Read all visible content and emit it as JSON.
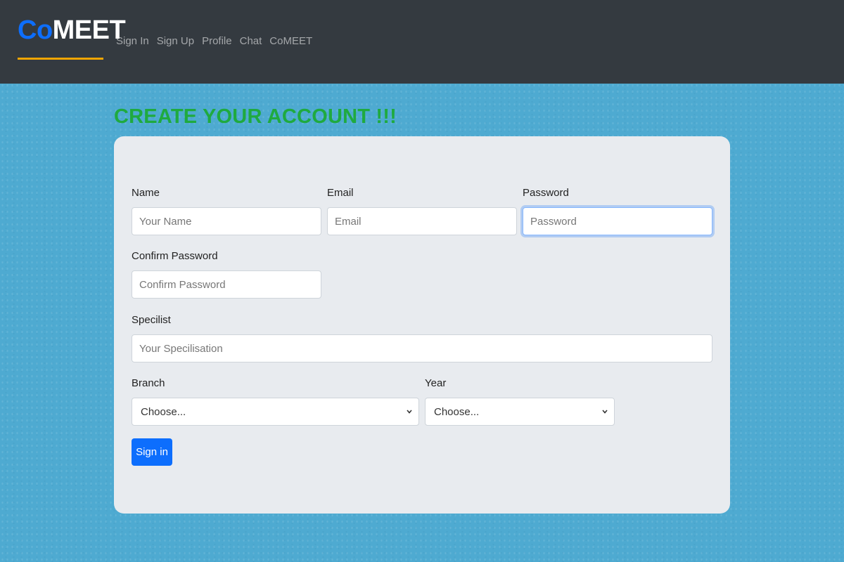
{
  "nav": {
    "brand_co": "Co",
    "brand_meet": "MEET",
    "links": [
      "Sign In",
      "Sign Up",
      "Profile",
      "Chat",
      "CoMEET"
    ],
    "brand_accent_color": "#0d6efd",
    "underline_color": "#f0a500"
  },
  "page": {
    "heading": "CREATE YOUR ACCOUNT !!!",
    "heading_color": "#1faa3f",
    "background_color": "#4eaad1"
  },
  "form": {
    "name": {
      "label": "Name",
      "placeholder": "Your Name",
      "value": ""
    },
    "email": {
      "label": "Email",
      "placeholder": "Email",
      "value": ""
    },
    "password": {
      "label": "Password",
      "placeholder": "Password",
      "value": "",
      "focused": true
    },
    "confirm_password": {
      "label": "Confirm Password",
      "placeholder": "Confirm Password",
      "value": ""
    },
    "specialist": {
      "label": "Specilist",
      "placeholder": "Your Specilisation",
      "value": ""
    },
    "branch": {
      "label": "Branch",
      "selected": "Choose..."
    },
    "year": {
      "label": "Year",
      "selected": "Choose..."
    },
    "submit_label": "Sign in",
    "submit_color": "#0d6efd"
  },
  "icons": {
    "select_arrow": "chevron-down-icon"
  }
}
